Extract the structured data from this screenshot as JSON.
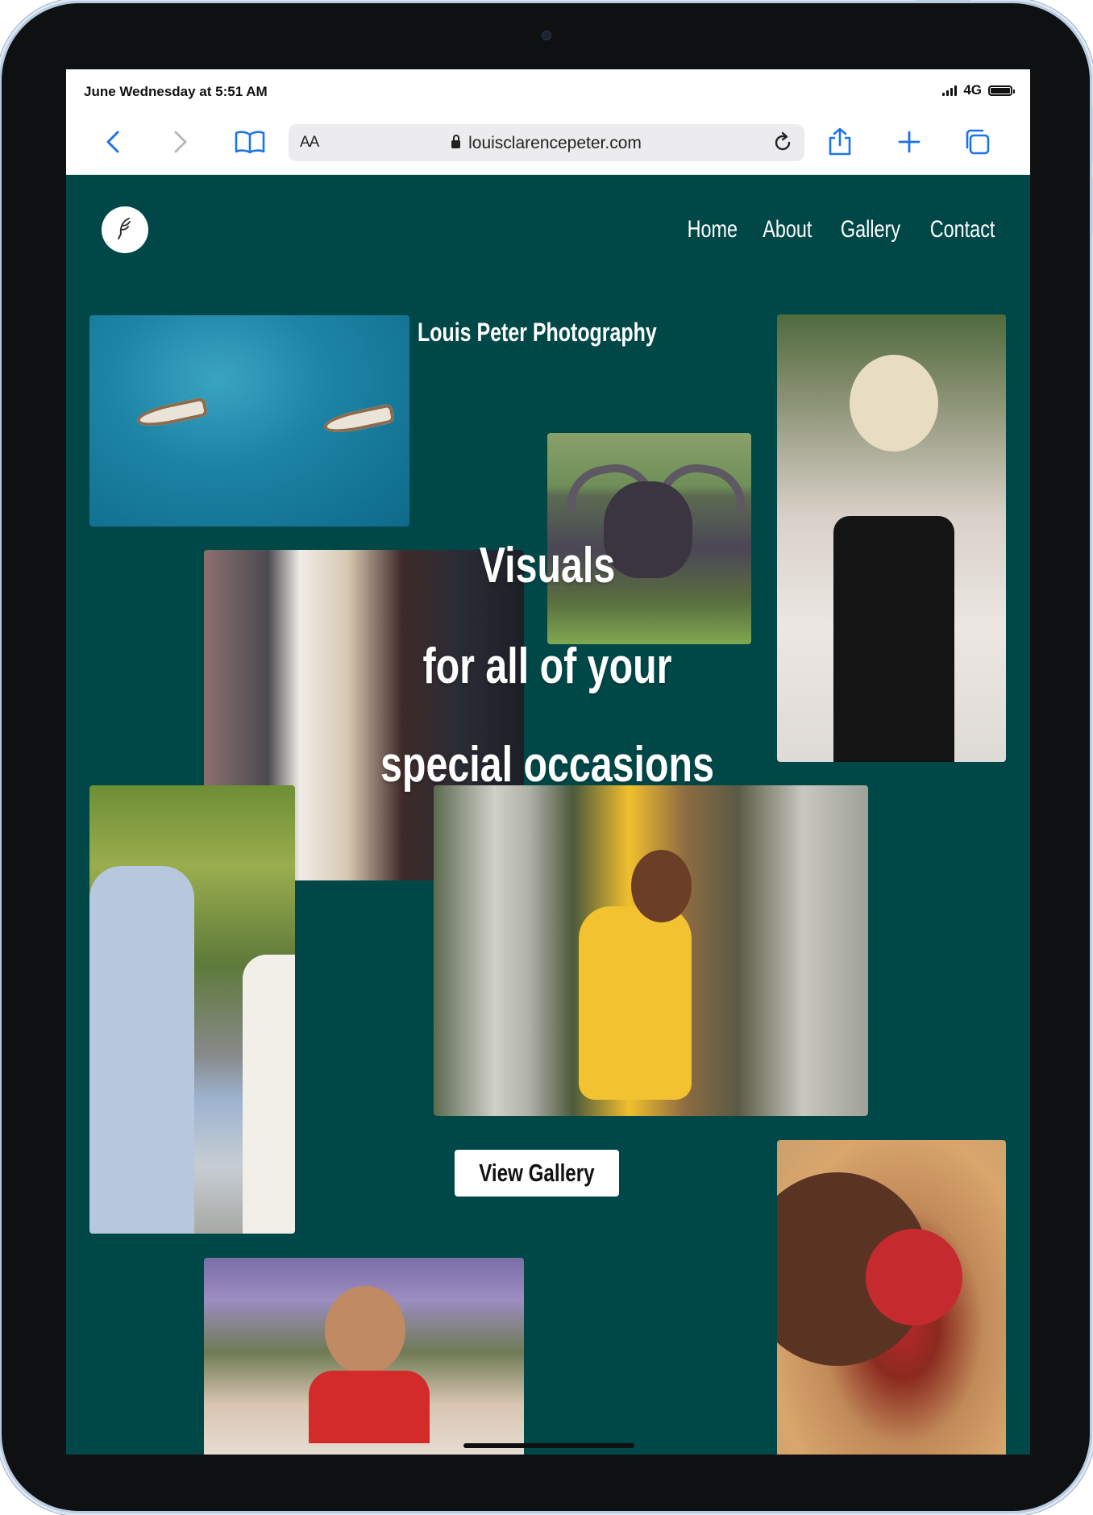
{
  "status_bar": {
    "time": "June Wednesday at 5:51 AM",
    "network": "4G",
    "icons": [
      "signal-icon",
      "battery-icon"
    ]
  },
  "browser": {
    "text_size_label": "AA",
    "url": "louisclarencepeter.com",
    "icons": [
      "back-icon",
      "forward-icon",
      "bookmarks-icon",
      "lock-icon",
      "reload-icon",
      "share-icon",
      "new-tab-icon",
      "tabs-icon"
    ]
  },
  "site": {
    "logo_icon": "feather-logo-icon",
    "nav": [
      "Home",
      "About",
      "Gallery",
      "Contact"
    ],
    "brand": "Louis Peter Photography",
    "headline_lines": [
      "Visuals",
      "for all of your",
      "special occasions"
    ],
    "cta_label": "View Gallery",
    "background_color": "#004848"
  }
}
